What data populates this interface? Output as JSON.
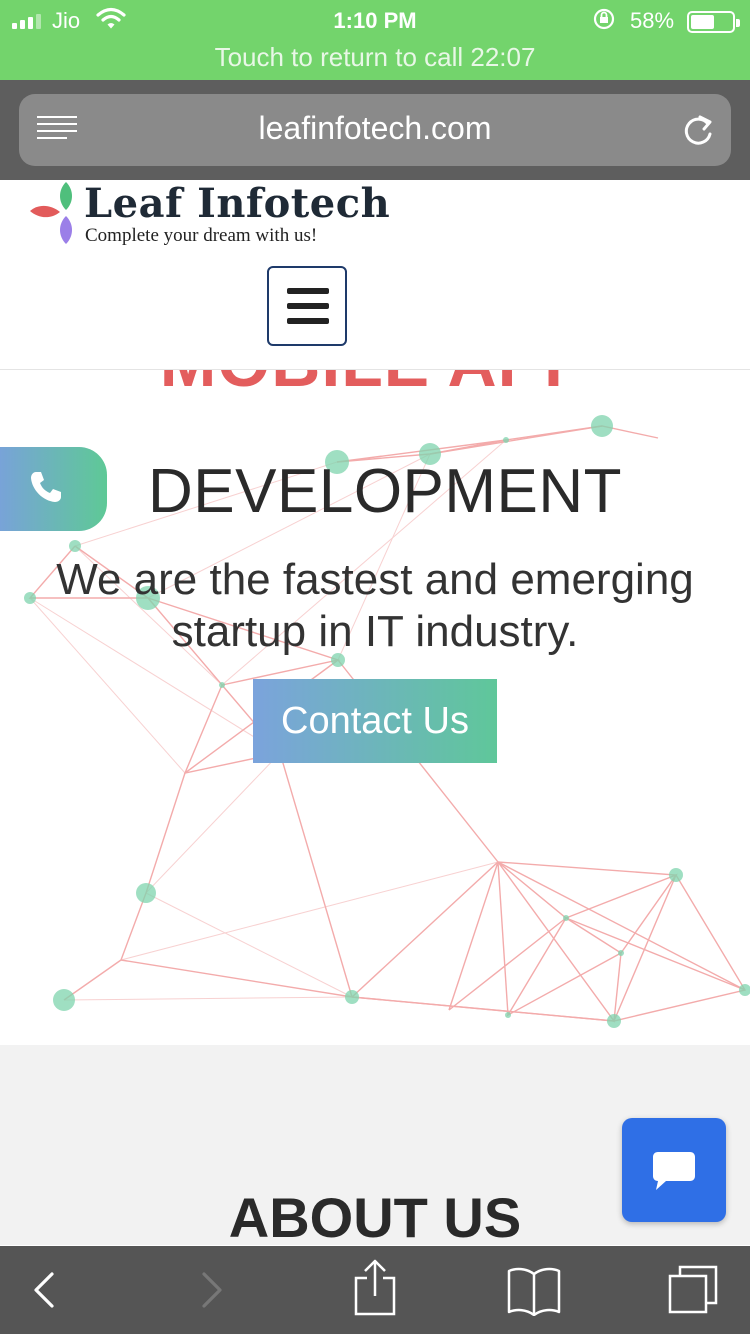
{
  "status_bar": {
    "carrier": "Jio",
    "time": "1:10 PM",
    "battery_percent": "58%",
    "battery_level": 0.58,
    "call_banner": "Touch to return to call 22:07",
    "background_color": "#73d46c"
  },
  "browser": {
    "url": "leafinfotech.com",
    "reader_icon": "reader-view-icon",
    "reload_icon": "reload-icon"
  },
  "site": {
    "logo_name": "Leaf Infotech",
    "logo_tagline": "Complete your dream with us!",
    "menu_icon": "hamburger-menu-icon"
  },
  "hero": {
    "partial_heading": "MOBILE APP",
    "heading": "DEVELOPMENT",
    "subtitle_line1": "We are the fastest and emerging",
    "subtitle_line2": "startup in IT industry.",
    "cta_label": "Contact Us",
    "accent_color": "#e35d5d",
    "gradient_start": "#7ba3dc",
    "gradient_end": "#5fc79a"
  },
  "about": {
    "title": "ABOUT US"
  },
  "floating": {
    "call_icon": "phone-icon",
    "chat_icon": "chat-bubble-icon",
    "chat_color": "#2f6fe6"
  },
  "toolbar": {
    "items": [
      "back-icon",
      "forward-icon",
      "share-icon",
      "bookmarks-icon",
      "tabs-icon"
    ]
  }
}
